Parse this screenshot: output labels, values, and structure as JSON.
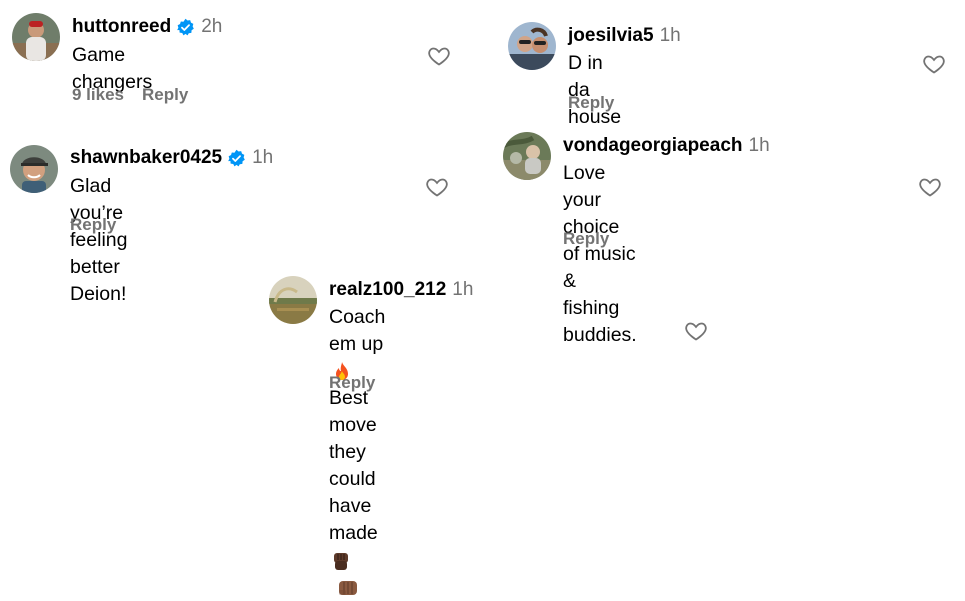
{
  "comments": [
    {
      "username": "huttonreed",
      "verified": true,
      "time": "2h",
      "text": "Game changers",
      "likes": "9 likes",
      "reply": "Reply",
      "avatar_icon": "avatar-baseball-player"
    },
    {
      "username": "joesilvia5",
      "verified": false,
      "time": "1h",
      "text": "D in da house",
      "reply": "Reply",
      "avatar_icon": "avatar-couple-selfie"
    },
    {
      "username": "shawnbaker0425",
      "verified": true,
      "time": "1h",
      "text": "Glad you’re feeling better Deion!",
      "reply": "Reply",
      "avatar_icon": "avatar-man-cap"
    },
    {
      "username": "vondageorgiapeach",
      "verified": false,
      "time": "1h",
      "text_line1": "Love your choice of music & fishing",
      "text_line2": "buddies.",
      "reply": "Reply",
      "avatar_icon": "avatar-outdoor-photo"
    },
    {
      "username": "realz100_212",
      "verified": false,
      "time": "1h",
      "text_part1": "Coach em up",
      "text_part2": "Best move they",
      "text_part3": "could have made",
      "emojis": [
        "fire",
        "raised-fist-dark",
        "oncoming-fist-medium-dark"
      ],
      "reply": "Reply",
      "avatar_icon": "avatar-landscape-field"
    }
  ],
  "colors": {
    "secondary_text": "#737373",
    "verified_blue": "#0095f6",
    "heart_outline": "#737373"
  }
}
